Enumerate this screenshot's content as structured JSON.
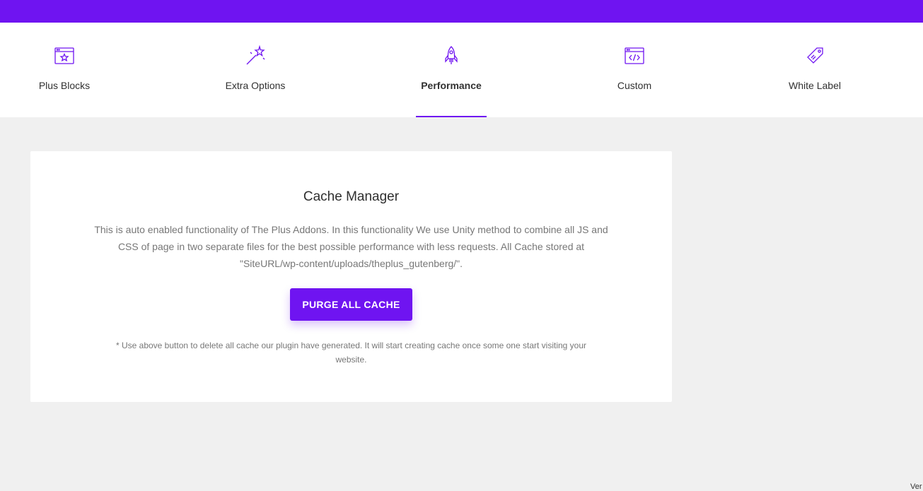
{
  "colors": {
    "accent": "#6f14f1",
    "background": "#f0f0f0",
    "card": "#ffffff",
    "muted_text": "#777777"
  },
  "tabs": [
    {
      "label": "Plus Blocks",
      "icon": "window-star-icon",
      "active": false
    },
    {
      "label": "Extra Options",
      "icon": "magic-wand-icon",
      "active": false
    },
    {
      "label": "Performance",
      "icon": "rocket-icon",
      "active": true
    },
    {
      "label": "Custom",
      "icon": "code-window-icon",
      "active": false
    },
    {
      "label": "White Label",
      "icon": "price-tag-icon",
      "active": false
    }
  ],
  "cache_manager": {
    "title": "Cache Manager",
    "description": "This is auto enabled functionality of The Plus Addons. In this functionality We use Unity method to combine all JS and CSS of page in two separate files for the best possible performance with less requests. All Cache stored at \"SiteURL/wp-content/uploads/theplus_gutenberg/\".",
    "button_label": "PURGE ALL CACHE",
    "note": "* Use above button to delete all cache our plugin have generated. It will start creating cache once some one start visiting your website."
  },
  "footer": {
    "version_fragment": "Ver"
  }
}
